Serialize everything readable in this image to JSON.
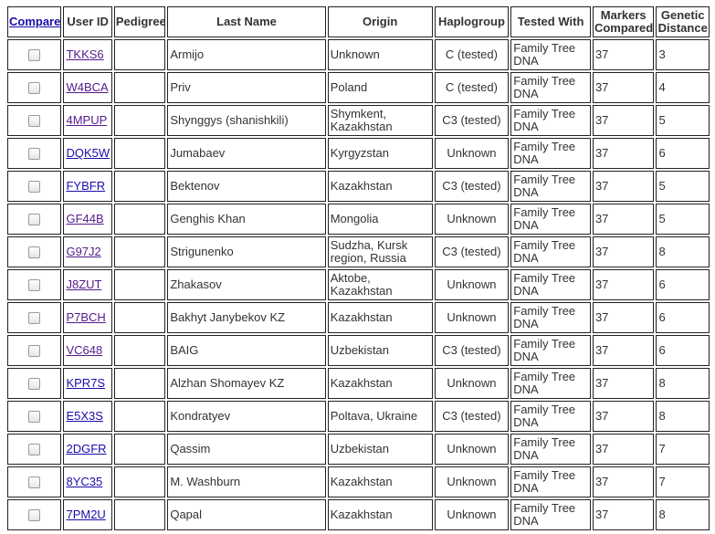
{
  "table": {
    "headers": {
      "compare": "Compare",
      "user_id": "User ID",
      "pedigree": "Pedigree",
      "last_name": "Last Name",
      "origin": "Origin",
      "haplogroup": "Haplogroup",
      "tested_with": "Tested With",
      "markers_compared": "Markers Compared",
      "genetic_distance": "Genetic Distance"
    },
    "rows": [
      {
        "checked": false,
        "user_id": "TKKS6",
        "visited": true,
        "pedigree": "",
        "last_name": "Armijo",
        "origin": "Unknown",
        "haplogroup": "C (tested)",
        "tested_with": "Family Tree DNA",
        "markers": "37",
        "distance": "3"
      },
      {
        "checked": false,
        "user_id": "W4BCA",
        "visited": true,
        "pedigree": "",
        "last_name": "Priv",
        "origin": "Poland",
        "haplogroup": "C (tested)",
        "tested_with": "Family Tree DNA",
        "markers": "37",
        "distance": "4"
      },
      {
        "checked": false,
        "user_id": "4MPUP",
        "visited": true,
        "pedigree": "",
        "last_name": "Shynggys (shanishkili)",
        "origin": "Shymkent, Kazakhstan",
        "haplogroup": "C3 (tested)",
        "tested_with": "Family Tree DNA",
        "markers": "37",
        "distance": "5"
      },
      {
        "checked": false,
        "user_id": "DQK5W",
        "visited": false,
        "pedigree": "",
        "last_name": "Jumabaev",
        "origin": "Kyrgyzstan",
        "haplogroup": "Unknown",
        "tested_with": "Family Tree DNA",
        "markers": "37",
        "distance": "6"
      },
      {
        "checked": false,
        "user_id": "FYBFR",
        "visited": false,
        "pedigree": "",
        "last_name": "Bektenov",
        "origin": "Kazakhstan",
        "haplogroup": "C3 (tested)",
        "tested_with": "Family Tree DNA",
        "markers": "37",
        "distance": "5"
      },
      {
        "checked": false,
        "user_id": "GF44B",
        "visited": true,
        "pedigree": "",
        "last_name": "Genghis Khan",
        "origin": "Mongolia",
        "haplogroup": "Unknown",
        "tested_with": "Family Tree DNA",
        "markers": "37",
        "distance": "5"
      },
      {
        "checked": false,
        "user_id": "G97J2",
        "visited": true,
        "pedigree": "",
        "last_name": "Strigunenko",
        "origin": "Sudzha, Kursk region, Russia",
        "haplogroup": "C3 (tested)",
        "tested_with": "Family Tree DNA",
        "markers": "37",
        "distance": "8"
      },
      {
        "checked": false,
        "user_id": "J8ZUT",
        "visited": true,
        "pedigree": "",
        "last_name": "Zhakasov",
        "origin": "Aktobe, Kazakhstan",
        "haplogroup": "Unknown",
        "tested_with": "Family Tree DNA",
        "markers": "37",
        "distance": "6"
      },
      {
        "checked": false,
        "user_id": "P7BCH",
        "visited": true,
        "pedigree": "",
        "last_name": "Bakhyt Janybekov KZ",
        "origin": "Kazakhstan",
        "haplogroup": "Unknown",
        "tested_with": "Family Tree DNA",
        "markers": "37",
        "distance": "6"
      },
      {
        "checked": false,
        "user_id": "VC648",
        "visited": true,
        "pedigree": "",
        "last_name": "BAIG",
        "origin": "Uzbekistan",
        "haplogroup": "C3 (tested)",
        "tested_with": "Family Tree DNA",
        "markers": "37",
        "distance": "6"
      },
      {
        "checked": false,
        "user_id": "KPR7S",
        "visited": false,
        "pedigree": "",
        "last_name": "Alzhan Shomayev KZ",
        "origin": "Kazakhstan",
        "haplogroup": "Unknown",
        "tested_with": "Family Tree DNA",
        "markers": "37",
        "distance": "8"
      },
      {
        "checked": false,
        "user_id": "E5X3S",
        "visited": false,
        "pedigree": "",
        "last_name": "Kondratyev",
        "origin": "Poltava, Ukraine",
        "haplogroup": "C3 (tested)",
        "tested_with": "Family Tree DNA",
        "markers": "37",
        "distance": "8"
      },
      {
        "checked": false,
        "user_id": "2DGFR",
        "visited": false,
        "pedigree": "",
        "last_name": "Qassim",
        "origin": "Uzbekistan",
        "haplogroup": "Unknown",
        "tested_with": "Family Tree DNA",
        "markers": "37",
        "distance": "7"
      },
      {
        "checked": false,
        "user_id": "8YC35",
        "visited": false,
        "pedigree": "",
        "last_name": "M. Washburn",
        "origin": "Kazakhstan",
        "haplogroup": "Unknown",
        "tested_with": "Family Tree DNA",
        "markers": "37",
        "distance": "7"
      },
      {
        "checked": false,
        "user_id": "7PM2U",
        "visited": false,
        "pedigree": "",
        "last_name": "Qapal",
        "origin": "Kazakhstan",
        "haplogroup": "Unknown",
        "tested_with": "Family Tree DNA",
        "markers": "37",
        "distance": "8"
      }
    ]
  },
  "colors": {
    "link_visited": "#551a8b",
    "link_unvisited": "#1a0dab",
    "border": "#222222"
  }
}
